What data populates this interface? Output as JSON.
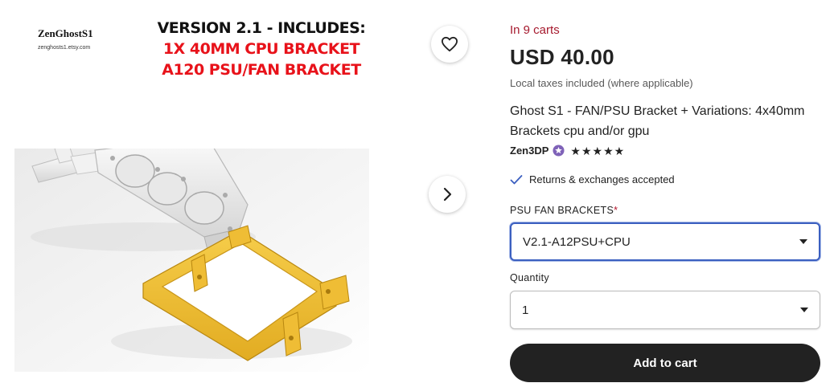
{
  "image": {
    "shop_logo_name": "ZenGhostS1",
    "shop_logo_url": "zenghosts1.etsy.com",
    "promo_lines": [
      "VERSION 2.1 - INCLUDES:",
      "1X 40MM CPU BRACKET",
      "A120 PSU/FAN BRACKET"
    ],
    "favorite_icon": "heart-icon",
    "next_icon": "chevron-right-icon"
  },
  "listing": {
    "in_carts": "In 9 carts",
    "price": "USD 40.00",
    "tax_note": "Local taxes included (where applicable)",
    "title": "Ghost S1 - FAN/PSU Bracket + Variations: 4x40mm Brackets cpu and/or gpu",
    "seller": "Zen3DP",
    "rating": 5,
    "returns": "Returns & exchanges accepted"
  },
  "variation": {
    "label": "PSU FAN BRACKETS",
    "required_mark": "*",
    "selected": "V2.1-A12PSU+CPU"
  },
  "quantity": {
    "label": "Quantity",
    "selected": "1"
  },
  "cart_button": "Add to cart",
  "colors": {
    "accent_red": "#a61a2e",
    "focus_blue": "#3b5fc0",
    "button_dark": "#222222",
    "bracket_yellow": "#f1c232"
  }
}
